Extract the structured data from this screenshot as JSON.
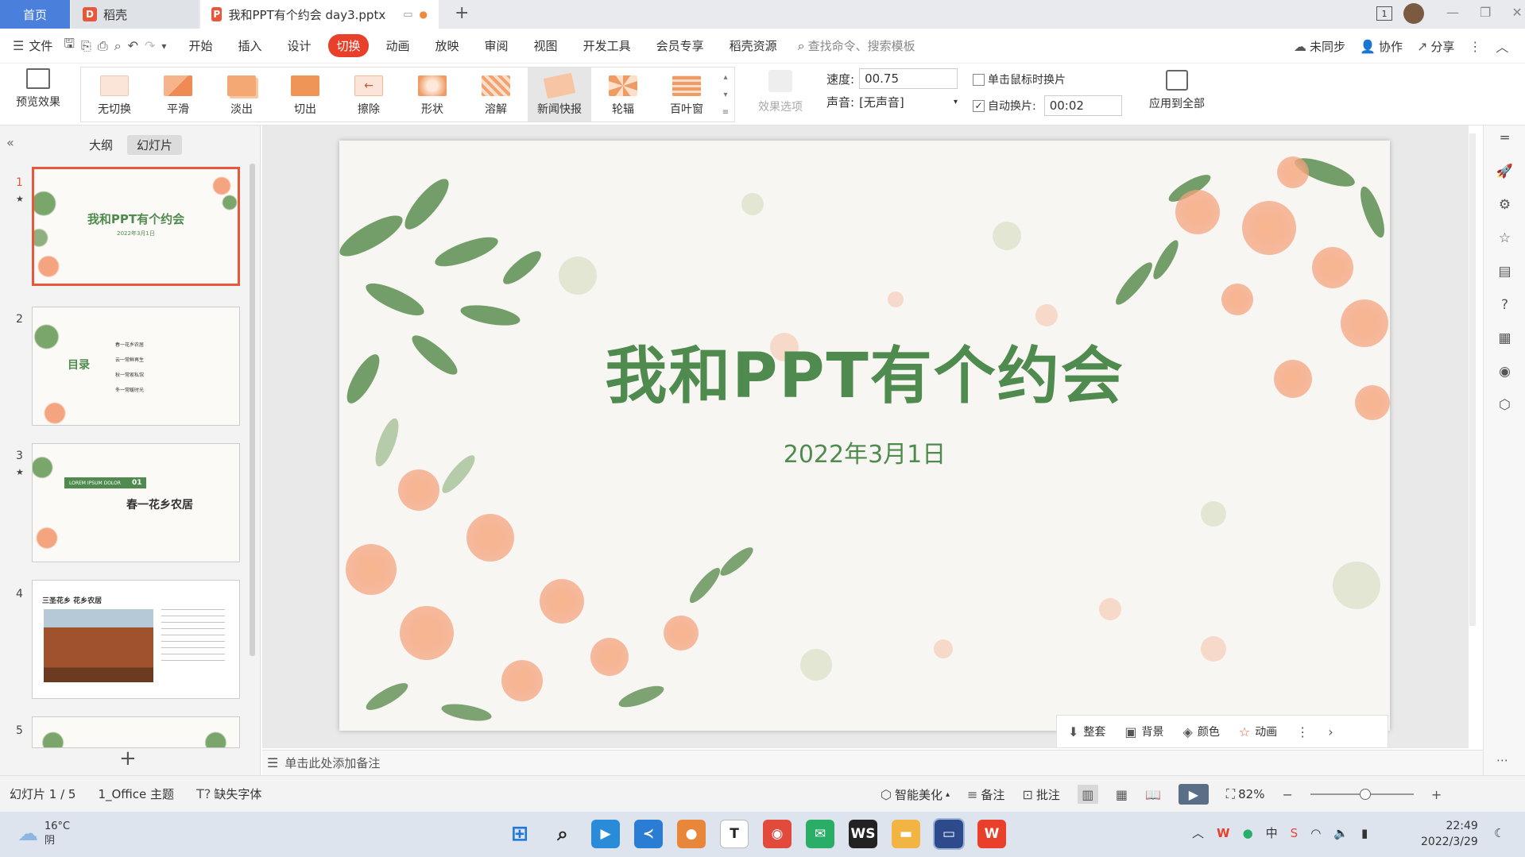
{
  "titlebar": {
    "home_tab": "首页",
    "docer_tab": "稻壳",
    "doc_tab": "我和PPT有个约会 day3.pptx",
    "new_tab": "+"
  },
  "menu": {
    "file": "文件",
    "items": [
      "开始",
      "插入",
      "设计",
      "切换",
      "动画",
      "放映",
      "审阅",
      "视图",
      "开发工具",
      "会员专享",
      "稻壳资源"
    ],
    "active": "切换",
    "search_placeholder": "查找命令、搜索模板",
    "sync": "未同步",
    "collab": "协作",
    "share": "分享"
  },
  "ribbon": {
    "preview": "预览效果",
    "transitions": [
      "无切换",
      "平滑",
      "淡出",
      "切出",
      "擦除",
      "形状",
      "溶解",
      "新闻快报",
      "轮辐",
      "百叶窗"
    ],
    "selected_transition": "新闻快报",
    "effect_options": "效果选项",
    "speed_label": "速度:",
    "speed_value": "00.75",
    "sound_label": "声音:",
    "sound_value": "[无声音]",
    "click_advance": "单击鼠标时换片",
    "auto_advance": "自动换片:",
    "auto_time": "00:02",
    "apply_all": "应用到全部"
  },
  "leftpane": {
    "tab_outline": "大纲",
    "tab_slides": "幻灯片",
    "slides": [
      {
        "num": "1",
        "title": "我和PPT有个约会",
        "sub": "2022年3月1日"
      },
      {
        "num": "2",
        "title": "目录",
        "items": [
          "春一花乡农居",
          "云一常鲜再生",
          "秋一常家私馆",
          "冬一常暖时光"
        ]
      },
      {
        "num": "3",
        "banner": "LOREM IPSUM DOLOR",
        "banner_num": "01",
        "title": "春一花乡农居"
      },
      {
        "num": "4",
        "title": "三圣花乡 花乡农居"
      },
      {
        "num": "5"
      }
    ],
    "add": "+"
  },
  "slide": {
    "title": "我和PPT有个约会",
    "date": "2022年3月1日"
  },
  "float_toolbar": {
    "items": [
      "整套",
      "背景",
      "颜色",
      "动画"
    ]
  },
  "notes_placeholder": "单击此处添加备注",
  "status": {
    "slide_counter": "幻灯片 1 / 5",
    "theme": "1_Office 主题",
    "missing_font": "缺失字体",
    "beautify": "智能美化",
    "notes": "备注",
    "comments": "批注",
    "zoom": "82%"
  },
  "taskbar": {
    "temp": "16°C",
    "weather": "阴",
    "time": "22:49",
    "date": "2022/3/29"
  },
  "colors": {
    "accent": "#e8402a",
    "title_green": "#4f8a4e",
    "home_blue": "#4a7fdc"
  }
}
